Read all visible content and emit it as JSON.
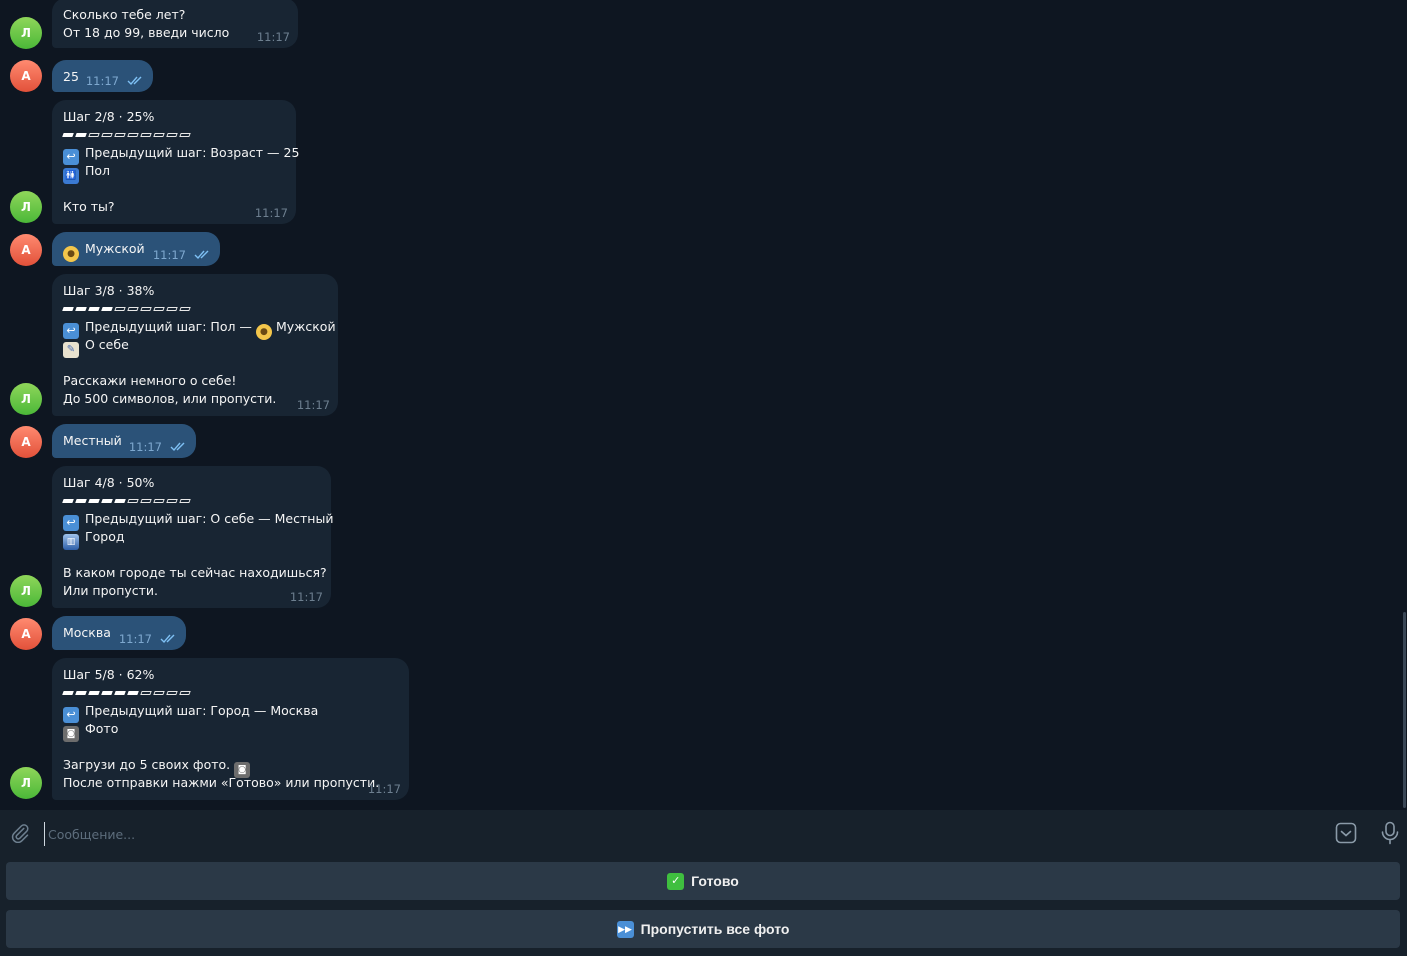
{
  "colors": {
    "background": "#0e1621",
    "incoming_bubble": "#182533",
    "outgoing_bubble": "#2b5278",
    "bot_avatar": "#5fc241",
    "user_avatar": "#ef6b52",
    "keyboard_button": "#2b3947"
  },
  "avatars": {
    "bot_letter": "Л",
    "user_letter": "А"
  },
  "messages": {
    "m1": {
      "line1": "Сколько тебе лет?",
      "line2": "От 18 до 99, введи число",
      "time": "11:17"
    },
    "m2": {
      "text": "25",
      "time": "11:17",
      "status": "read"
    },
    "m3": {
      "step": "Шаг 2/8 · 25%",
      "progress_filled": 2,
      "progress_total": 10,
      "prev": "Предыдущий шаг: Возраст — 25",
      "prev_icon": "back-arrow-icon",
      "title": "Пол",
      "title_icon": "restroom-icon",
      "body1": "Кто ты?",
      "time": "11:17"
    },
    "m4": {
      "text": "Мужской",
      "icon": "man-face-icon",
      "time": "11:17",
      "status": "read"
    },
    "m5": {
      "step": "Шаг 3/8 · 38%",
      "progress_filled": 4,
      "progress_total": 10,
      "prev_before": "Предыдущий шаг: Пол —",
      "prev_after": "Мужской",
      "prev_icon": "back-arrow-icon",
      "title": "О себе",
      "title_icon": "memo-icon",
      "body1": "Расскажи немного о себе!",
      "body2": "До 500 символов, или пропусти.",
      "time": "11:17"
    },
    "m6": {
      "text": "Местный",
      "time": "11:17",
      "status": "read"
    },
    "m7": {
      "step": "Шаг 4/8 · 50%",
      "progress_filled": 5,
      "progress_total": 10,
      "prev": "Предыдущий шаг: О себе — Местный",
      "prev_icon": "back-arrow-icon",
      "title": "Город",
      "title_icon": "cityscape-icon",
      "body1": "В каком городе ты сейчас находишься?",
      "body2": "Или пропусти.",
      "time": "11:17"
    },
    "m8": {
      "text": "Москва",
      "time": "11:17",
      "status": "read"
    },
    "m9": {
      "step": "Шаг 5/8 · 62%",
      "progress_filled": 6,
      "progress_total": 10,
      "prev": "Предыдущий шаг: Город — Москва",
      "prev_icon": "back-arrow-icon",
      "title": "Фото",
      "title_icon": "camera-flash-icon",
      "body1": "Загрузи до 5 своих фото.",
      "body2": "После отправки нажми «Готово» или пропусти.",
      "time": "11:17"
    }
  },
  "composer": {
    "placeholder": "Сообщение..."
  },
  "keyboard": {
    "done": {
      "label": "Готово",
      "icon": "check-mark-icon"
    },
    "skip": {
      "label": "Пропустить все фото",
      "icon": "fast-forward-icon"
    }
  }
}
